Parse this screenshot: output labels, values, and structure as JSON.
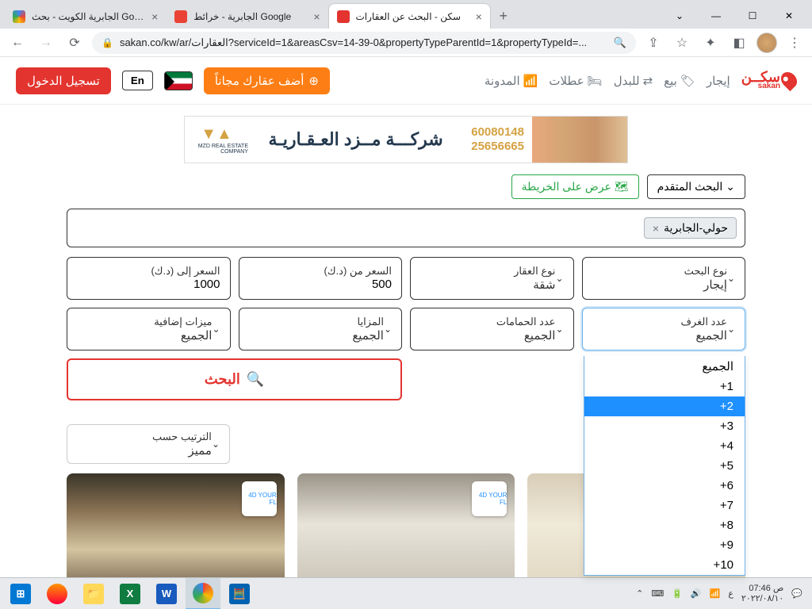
{
  "browser": {
    "tabs": [
      {
        "title": "الجابرية الكويت - بحث Google",
        "favicon": "#4285f4"
      },
      {
        "title": "الجابرية - خرائط Google",
        "favicon": "#34a853"
      },
      {
        "title": "سكن - البحث عن العقارات",
        "favicon": "#e3342f",
        "active": true
      }
    ],
    "url": "sakan.co/kw/ar/العقارات?serviceId=1&areasCsv=14-39-0&propertyTypeParentId=1&propertyTypeId=..."
  },
  "header": {
    "logo_top": "سكــن",
    "logo_bottom": "sakan",
    "nav": {
      "rent": "إيجار",
      "sale": "بيع",
      "exchange": "للبدل",
      "vacations": "عطلات",
      "blog": "المدونة"
    },
    "add_btn": "أضف عقارك مجاناً",
    "lang": "En",
    "login": "تسجيل الدخول"
  },
  "banner": {
    "phone1": "60080148",
    "phone2": "25656665",
    "company": "شركـــة مــزد العـقـاريـة",
    "sub": "MZD REAL ESTATE COMPANY"
  },
  "filters": {
    "advanced": "البحث المتقدم",
    "map_view": "عرض على الخريطة",
    "tag": "حولي-الجابرية",
    "search_type": {
      "label": "نوع البحث",
      "value": "إيجار"
    },
    "property_type": {
      "label": "نوع العقار",
      "value": "شقة"
    },
    "price_from": {
      "label": "السعر من (د.ك)",
      "value": "500"
    },
    "price_to": {
      "label": "السعر إلى (د.ك)",
      "value": "1000"
    },
    "rooms": {
      "label": "عدد الغرف",
      "value": "الجميع"
    },
    "baths": {
      "label": "عدد الحمامات",
      "value": "الجميع"
    },
    "features": {
      "label": "المزايا",
      "value": "الجميع"
    },
    "extra": {
      "label": "ميزات إضافية",
      "value": "الجميع"
    },
    "rooms_options": [
      "الجميع",
      "1+",
      "2+",
      "3+",
      "4+",
      "5+",
      "6+",
      "7+",
      "8+",
      "9+",
      "10+"
    ],
    "rooms_selected_index": 2,
    "search_btn": "البحث"
  },
  "sort": {
    "label": "الترتيب حسب",
    "value": "مميز"
  },
  "taskbar": {
    "time": "07:46 ص",
    "date": "٢٠٢٢/٠٨/١٠",
    "lang": "ع"
  }
}
